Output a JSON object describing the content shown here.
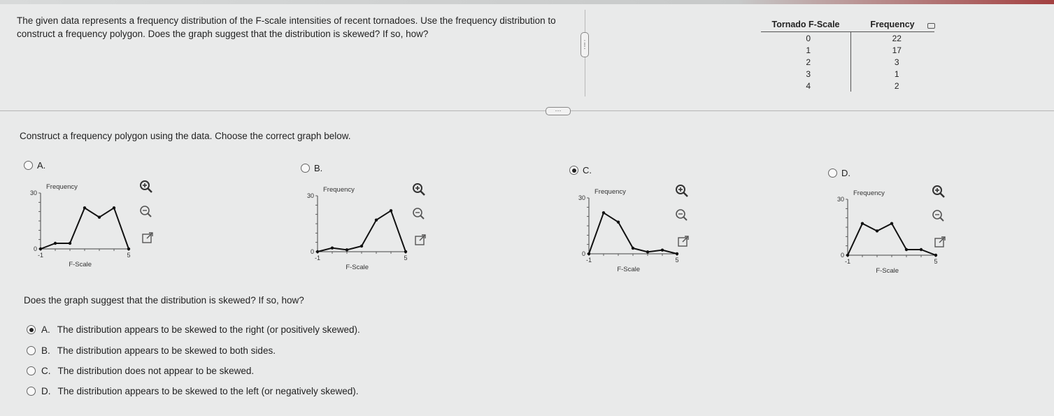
{
  "question": {
    "text": "The given data represents a frequency distribution of the F-scale intensities of recent tornadoes. Use the frequency distribution to construct a frequency polygon. Does the graph suggest that the distribution is skewed? If so, how?"
  },
  "table": {
    "headers": [
      "Tornado F-Scale",
      "Frequency"
    ],
    "rows": [
      [
        "0",
        "22"
      ],
      [
        "1",
        "17"
      ],
      [
        "2",
        "3"
      ],
      [
        "3",
        "1"
      ],
      [
        "4",
        "2"
      ]
    ]
  },
  "part1": {
    "instruction": "Construct a frequency polygon using the data. Choose the correct graph below.",
    "selected": "C",
    "options": [
      {
        "label": "A.",
        "selected": false
      },
      {
        "label": "B.",
        "selected": false
      },
      {
        "label": "C.",
        "selected": true
      },
      {
        "label": "D.",
        "selected": false
      }
    ]
  },
  "chart_data": [
    {
      "type": "line",
      "option": "A",
      "ylabel": "Frequency",
      "xlabel": "F-Scale",
      "x_ticks": [
        "-1",
        "5"
      ],
      "y_ticks": [
        "0",
        "30"
      ],
      "xlim": [
        -1,
        5
      ],
      "ylim": [
        0,
        30
      ],
      "x": [
        -1,
        0,
        1,
        2,
        3,
        4,
        5
      ],
      "y": [
        0,
        3,
        3,
        22,
        17,
        22,
        0
      ]
    },
    {
      "type": "line",
      "option": "B",
      "ylabel": "Frequency",
      "xlabel": "F-Scale",
      "x_ticks": [
        "-1",
        "5"
      ],
      "y_ticks": [
        "0",
        "30"
      ],
      "xlim": [
        -1,
        5
      ],
      "ylim": [
        0,
        30
      ],
      "x": [
        -1,
        0,
        1,
        2,
        3,
        4,
        5
      ],
      "y": [
        0,
        2,
        1,
        3,
        17,
        22,
        0
      ]
    },
    {
      "type": "line",
      "option": "C",
      "ylabel": "Frequency",
      "xlabel": "F-Scale",
      "x_ticks": [
        "-1",
        "5"
      ],
      "y_ticks": [
        "0",
        "30"
      ],
      "xlim": [
        -1,
        5
      ],
      "ylim": [
        0,
        30
      ],
      "x": [
        -1,
        0,
        1,
        2,
        3,
        4,
        5
      ],
      "y": [
        0,
        22,
        17,
        3,
        1,
        2,
        0
      ]
    },
    {
      "type": "line",
      "option": "D",
      "ylabel": "Frequency",
      "xlabel": "F-Scale",
      "x_ticks": [
        "-1",
        "5"
      ],
      "y_ticks": [
        "0",
        "30"
      ],
      "xlim": [
        -1,
        5
      ],
      "ylim": [
        0,
        30
      ],
      "x": [
        -1,
        0,
        1,
        2,
        3,
        4,
        5
      ],
      "y": [
        0,
        17,
        13,
        17,
        3,
        3,
        0
      ]
    }
  ],
  "part2": {
    "question": "Does the graph suggest that the distribution is skewed? If so, how?",
    "answers": [
      {
        "letter": "A.",
        "text": "The distribution appears to be skewed to the right (or positively skewed).",
        "selected": true
      },
      {
        "letter": "B.",
        "text": "The distribution appears to be skewed to both sides.",
        "selected": false
      },
      {
        "letter": "C.",
        "text": "The distribution does not appear to be skewed.",
        "selected": false
      },
      {
        "letter": "D.",
        "text": "The distribution appears to be skewed to the left (or negatively skewed).",
        "selected": false
      }
    ]
  },
  "icons": {
    "zoom_in": "zoom-in-icon",
    "zoom_out": "zoom-out-icon",
    "open_external": "open-external-icon"
  }
}
